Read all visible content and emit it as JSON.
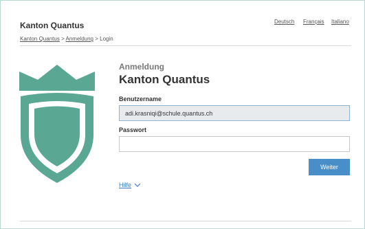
{
  "header": {
    "brand": "Kanton Quantus",
    "languages": [
      "Deutsch",
      "Français",
      "Italiano"
    ]
  },
  "breadcrumb": {
    "items": [
      "Kanton Quantus",
      "Anmeldung",
      "Login"
    ],
    "separator": ">"
  },
  "login": {
    "subtitle": "Anmeldung",
    "title": "Kanton Quantus",
    "username_label": "Benutzername",
    "username_value": "adi.krasniqi@schule.quantus.ch",
    "password_label": "Passwort",
    "password_value": "",
    "submit_label": "Weiter",
    "help_label": "Hilfe"
  },
  "colors": {
    "accent": "#5aa793",
    "button": "#4a8ec9",
    "link": "#3a7bbf"
  },
  "icons": {
    "logo": "shield-crown-icon",
    "help_toggle": "chevron-down-icon"
  }
}
